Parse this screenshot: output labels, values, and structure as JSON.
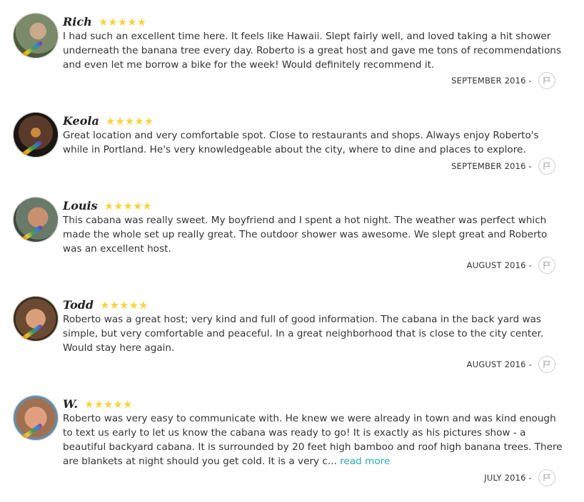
{
  "reviews": [
    {
      "name": "Rich",
      "rating": 5,
      "text": "I had such an excellent time here. It feels like Hawaii. Slept fairly well, and loved taking a hit shower underneath the banana tree every day. Roberto is a great host and gave me tons of recommendations and even let me borrow a bike for the week! Would definitely recommend it.",
      "date": "SEPTEMBER 2016 -",
      "avatar_color": "#8a9a7a"
    },
    {
      "name": "Keola",
      "rating": 5,
      "text": "Great location and very comfortable spot. Close to restaurants and shops. Always enjoy Roberto's while in Portland. He's very knowledgeable about the city, where to dine and places to explore.",
      "date": "SEPTEMBER 2016 -",
      "avatar_color": "#3a2a22"
    },
    {
      "name": "Louis",
      "rating": 5,
      "text": "This cabana was really sweet. My boyfriend and I spent a hot night. The weather was perfect which made the whole set up really great. The outdoor shower was awesome. We slept great and Roberto was an excellent host.",
      "date": "AUGUST 2016 -",
      "avatar_color": "#5a6a5a"
    },
    {
      "name": "Todd",
      "rating": 5,
      "text": "Roberto was a great host; very kind and full of good information. The cabana in the back yard was simple, but very comfortable and peaceful. In a great neighborhood that is close to the city center. Would stay here again.",
      "date": "AUGUST 2016 -",
      "avatar_color": "#8a5a3a"
    },
    {
      "name": "W.",
      "rating": 5,
      "text": "Roberto was very easy to communicate with. He knew we were already in town and was kind enough to text us early to let us know the cabana was ready to go! It is exactly as his pictures show - a beautiful backyard cabana. It is surrounded by 20 feet high bamboo and roof high banana trees. There are blankets at night should you get cold. It is a very c...",
      "read_more": "read more",
      "date": "JULY 2016 -",
      "avatar_color": "#b57a5a"
    }
  ],
  "colors": {
    "star": "#f6d33e",
    "link": "#2aa7b8"
  },
  "icons": {
    "flag": "flag-icon"
  }
}
